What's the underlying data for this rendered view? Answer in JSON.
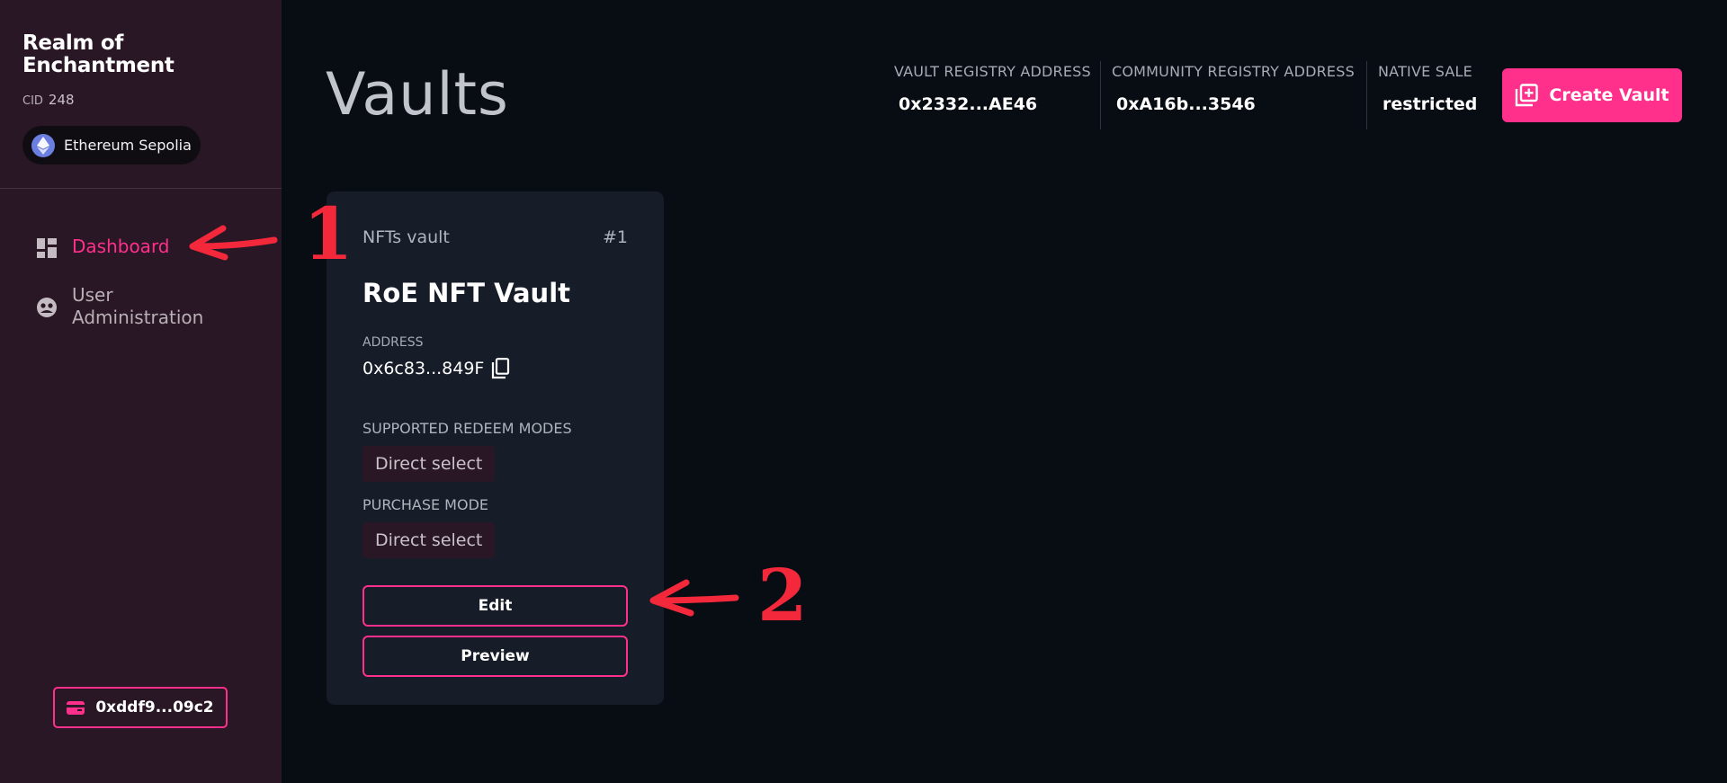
{
  "sidebar": {
    "brand": "Realm of Enchantment",
    "cid_label": "CID",
    "cid_value": "248",
    "network": {
      "name": "Ethereum Sepolia",
      "icon": "ethereum-icon"
    },
    "nav": [
      {
        "label": "Dashboard",
        "icon": "dashboard-icon",
        "active": true
      },
      {
        "label": "User Administration",
        "icon": "users-icon",
        "active": false
      }
    ],
    "wallet": {
      "address": "0xddf9...09c2",
      "icon": "wallet-icon"
    }
  },
  "header": {
    "title": "Vaults",
    "vault_registry_label": "VAULT REGISTRY ADDRESS",
    "vault_registry_value": "0x2332...AE46",
    "community_registry_label": "COMMUNITY REGISTRY ADDRESS",
    "community_registry_value": "0xA16b...3546",
    "native_sale_label": "NATIVE SALE",
    "native_sale_value": "restricted",
    "create_button": "Create Vault"
  },
  "vault_card": {
    "type": "NFTs vault",
    "index": "#1",
    "name": "RoE NFT Vault",
    "address_label": "ADDRESS",
    "address": "0x6c83...849F",
    "redeem_label": "SUPPORTED REDEEM MODES",
    "redeem_mode": "Direct select",
    "purchase_label": "PURCHASE MODE",
    "purchase_mode": "Direct select",
    "edit_button": "Edit",
    "preview_button": "Preview"
  },
  "annotations": {
    "marker_1": "1",
    "marker_2": "2"
  },
  "colors": {
    "accent": "#ff2f8c",
    "sidebar_bg": "#2a1725",
    "page_bg": "#080d14",
    "card_bg": "#161c28",
    "annotation": "#f3283a"
  }
}
